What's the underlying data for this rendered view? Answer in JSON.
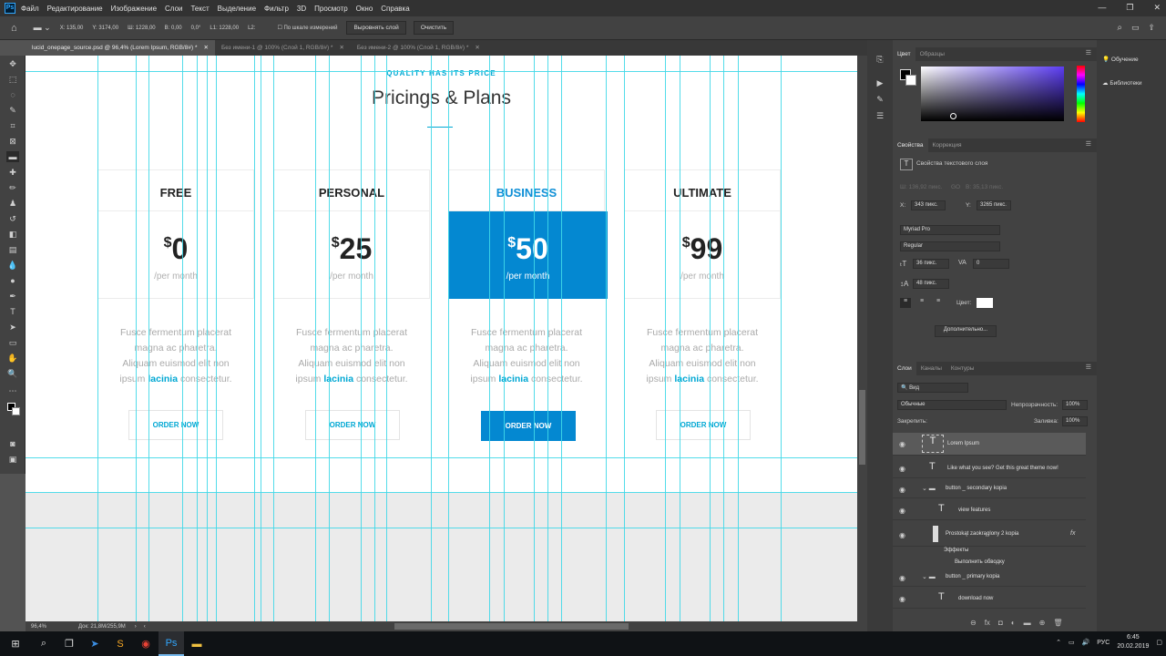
{
  "menubar": {
    "app_icon": "Ps",
    "items": [
      "Файл",
      "Редактирование",
      "Изображение",
      "Слои",
      "Текст",
      "Выделение",
      "Фильтр",
      "3D",
      "Просмотр",
      "Окно",
      "Справка"
    ]
  },
  "options": {
    "x": "X: 135,00",
    "y": "Y: 3174,00",
    "w": "Ш: 1228,00",
    "h": "В: 0,00",
    "angle": "0,0°",
    "l1": "L1: 1228,00",
    "l2": "L2:",
    "scale_label": "По шкале измерений",
    "align_btn": "Выровнять слой",
    "clear_btn": "Очистить"
  },
  "tabs": [
    {
      "label": "lucid_onepage_source.psd @ 96,4% (Lorem Ipsum, RGB/8#) *"
    },
    {
      "label": "Без имени-1 @ 100% (Слой 1, RGB/8#) *"
    },
    {
      "label": "Без имени-2 @ 100% (Слой 1, RGB/8#) *"
    }
  ],
  "page": {
    "kicker": "QUALITY HAS ITS PRICE",
    "heading": "Pricings & Plans",
    "plans": [
      {
        "name": "FREE",
        "currency": "$",
        "price": "0",
        "per": "/per month",
        "order": "ORDER NOW"
      },
      {
        "name": "PERSONAL",
        "currency": "$",
        "price": "25",
        "per": "/per month",
        "order": "ORDER NOW"
      },
      {
        "name": "BUSINESS",
        "currency": "$",
        "price": "50",
        "per": "/per month",
        "order": "ORDER NOW"
      },
      {
        "name": "ULTIMATE",
        "currency": "$",
        "price": "99",
        "per": "/per month",
        "order": "ORDER NOW"
      }
    ],
    "desc1": "Fusce fermentum placerat",
    "desc2": "magna ac pharetra.",
    "desc3": "Aliquam euismod elit non",
    "desc4a": "ipsum ",
    "desc4b": "lacinia",
    "desc4c": " consectetur."
  },
  "status": {
    "zoom": "96,4%",
    "doc": "Док: 21,8M/255,9M"
  },
  "color_panel": {
    "tabs": [
      "Цвет",
      "Образцы"
    ]
  },
  "props": {
    "tabs": [
      "Свойства",
      "Коррекция"
    ],
    "title": "Свойства текстового слоя",
    "w": "Ш: 136,92 пикс.",
    "go": "GO",
    "h": "В: 35,13 пикс.",
    "x_lbl": "X:",
    "x": "343 пикс.",
    "y_lbl": "Y:",
    "y": "3265 пикс.",
    "font": "Myriad Pro",
    "style": "Regular",
    "size": "36 пикс.",
    "tracking": "0",
    "leading": "48 пикс.",
    "color_lbl": "Цвет:",
    "more": "Дополнительно..."
  },
  "layers": {
    "tabs": [
      "Слои",
      "Каналы",
      "Контуры"
    ],
    "filter": "Вид",
    "blend": "Обычные",
    "opacity_lbl": "Непрозрачность:",
    "opacity": "100%",
    "lock_lbl": "Закрепить:",
    "fill_lbl": "Заливка:",
    "fill": "100%",
    "items": [
      "Lorem Ipsum",
      "Like what you see? Get this great theme now!",
      "button _ secondary kopia",
      "view features",
      "Prostokąt zaokrąglony 2 kopia",
      "Эффекты",
      "Выполнить обводку",
      "button _ primary kopia",
      "download now"
    ]
  },
  "right": {
    "learn": "Обучение",
    "libraries": "Библиотеки"
  },
  "tray": {
    "lang": "РУС",
    "time": "6:45",
    "date": "20.02.2019"
  }
}
